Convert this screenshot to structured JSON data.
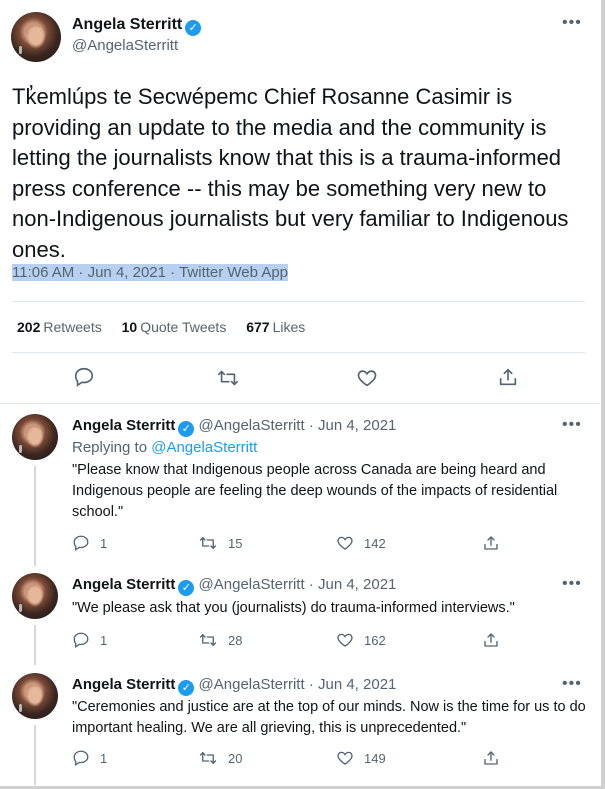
{
  "main_tweet": {
    "author_name": "Angela Sterritt",
    "author_handle": "@AngelaSterritt",
    "more_icon": "more-horizontal-icon",
    "text": "Tk̓emlúps te Secwépemc Chief Rosanne Casimir is providing an update to the media and the community is letting the journalists know that this is a trauma-informed press conference -- this may be something very new to non-Indigenous journalists but very familiar to Indigenous ones.",
    "time": "11:06 AM · Jun 4, 2021",
    "separator": " · ",
    "source": "Twitter Web App",
    "stats": {
      "retweets_count": "202",
      "retweets_label": "Retweets",
      "quotes_count": "10",
      "quotes_label": "Quote Tweets",
      "likes_count": "677",
      "likes_label": "Likes"
    },
    "actions": [
      "reply-icon",
      "retweet-icon",
      "like-icon",
      "share-icon"
    ]
  },
  "replies": [
    {
      "author_name": "Angela Sterritt",
      "author_handle": "@AngelaSterritt",
      "date": "· Jun 4, 2021",
      "replying_prefix": "Replying to ",
      "replying_to": "@AngelaSterritt",
      "text": "\"Please know that Indigenous people across Canada are being heard and Indigenous people are feeling the deep wounds of the impacts of residential school.\"",
      "reply_count": "1",
      "retweet_count": "15",
      "like_count": "142"
    },
    {
      "author_name": "Angela Sterritt",
      "author_handle": "@AngelaSterritt",
      "date": "· Jun 4, 2021",
      "text": "\"We please ask that you (journalists) do trauma-informed interviews.\"",
      "reply_count": "1",
      "retweet_count": "28",
      "like_count": "162"
    },
    {
      "author_name": "Angela Sterritt",
      "author_handle": "@AngelaSterritt",
      "date": "· Jun 4, 2021",
      "text": "\"Ceremonies and justice are at the top of our minds.  Now is the time for us to do important healing. We are all grieving, this is unprecedented.\"",
      "reply_count": "1",
      "retweet_count": "20",
      "like_count": "149"
    }
  ],
  "colors": {
    "accent": "#1d9bf0",
    "secondary_text": "#536471",
    "selection_highlight": "#b8d0ef"
  }
}
